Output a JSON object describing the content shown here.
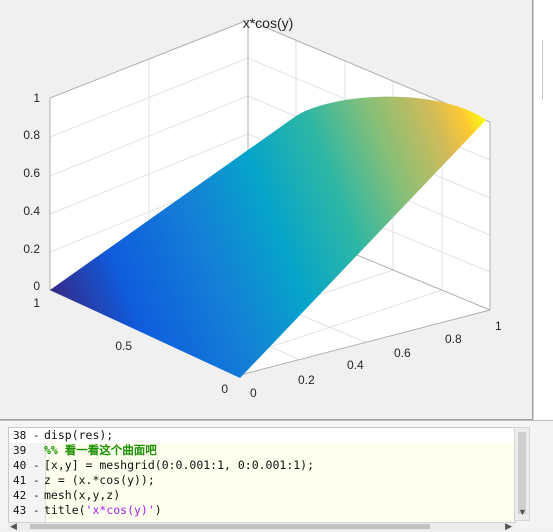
{
  "figure": {
    "title": "x*cos(y)",
    "tick_labels": {
      "z": [
        "0",
        "0.2",
        "0.4",
        "0.6",
        "0.8",
        "1"
      ],
      "y": [
        "0",
        "0.5",
        "1"
      ],
      "x": [
        "0",
        "0.2",
        "0.4",
        "0.6",
        "0.8",
        "1"
      ]
    }
  },
  "chart_data": {
    "type": "surface",
    "title": "x*cos(y)",
    "function": "z = x*cos(y)",
    "x_range": [
      0,
      1
    ],
    "y_range": [
      0,
      1
    ],
    "zlim": [
      0,
      1
    ],
    "grid": true,
    "colormap": "parula"
  },
  "editor": {
    "lines": [
      {
        "num": "38",
        "dash": "-",
        "code": "disp(res);",
        "kind": "code"
      },
      {
        "num": "39",
        "dash": "",
        "code": "%% 看一看这个曲面吧",
        "kind": "comment"
      },
      {
        "num": "40",
        "dash": "-",
        "code": "[x,y] = meshgrid(0:0.001:1, 0:0.001:1);",
        "kind": "code"
      },
      {
        "num": "41",
        "dash": "-",
        "code": "z = (x.*cos(y));",
        "kind": "code"
      },
      {
        "num": "42",
        "dash": "-",
        "code": "mesh(x,y,z)",
        "kind": "code"
      },
      {
        "num": "43",
        "dash": "-",
        "code_pre": "title(",
        "code_str": "'x*cos(y)'",
        "code_post": ")",
        "kind": "string"
      }
    ]
  }
}
